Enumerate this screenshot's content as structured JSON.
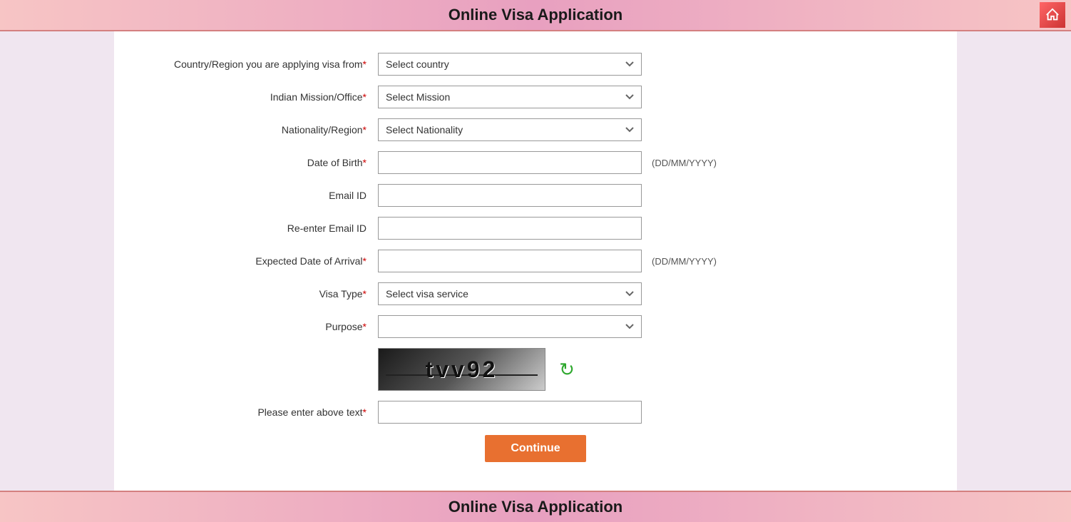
{
  "header": {
    "title": "Online Visa Application",
    "home_icon_label": "home"
  },
  "footer": {
    "title": "Online Visa Application"
  },
  "form": {
    "fields": [
      {
        "id": "country",
        "label": "Country/Region you are applying visa from",
        "required": true,
        "type": "select",
        "placeholder": "Select country",
        "hint": ""
      },
      {
        "id": "mission",
        "label": "Indian Mission/Office",
        "required": true,
        "type": "select",
        "placeholder": "Select Mission",
        "hint": ""
      },
      {
        "id": "nationality",
        "label": "Nationality/Region",
        "required": true,
        "type": "select",
        "placeholder": "Select Nationality",
        "hint": ""
      },
      {
        "id": "dob",
        "label": "Date of Birth",
        "required": true,
        "type": "text",
        "placeholder": "",
        "hint": "(DD/MM/YYYY)"
      },
      {
        "id": "email",
        "label": "Email ID",
        "required": false,
        "type": "text",
        "placeholder": "",
        "hint": ""
      },
      {
        "id": "reemail",
        "label": "Re-enter Email ID",
        "required": false,
        "type": "text",
        "placeholder": "",
        "hint": ""
      },
      {
        "id": "arrival",
        "label": "Expected Date of Arrival",
        "required": true,
        "type": "text",
        "placeholder": "",
        "hint": "(DD/MM/YYYY)"
      },
      {
        "id": "visatype",
        "label": "Visa Type",
        "required": true,
        "type": "select",
        "placeholder": "Select visa service",
        "hint": ""
      },
      {
        "id": "purpose",
        "label": "Purpose",
        "required": true,
        "type": "select",
        "placeholder": "",
        "hint": ""
      }
    ],
    "captcha": {
      "text": "tvv92",
      "label": "Please enter above text",
      "required": true
    },
    "continue_button": "Continue"
  }
}
